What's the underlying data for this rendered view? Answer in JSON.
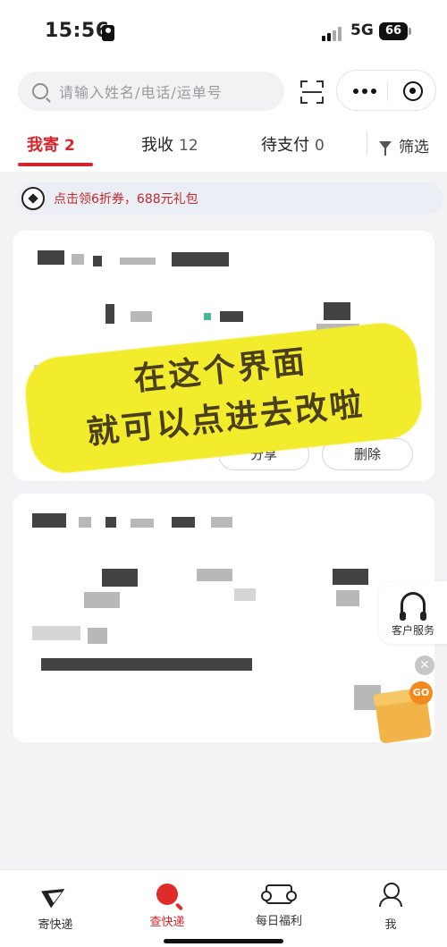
{
  "status_bar": {
    "time": "15:56",
    "network": "5G",
    "battery": "66"
  },
  "search": {
    "placeholder": "请输入姓名/电话/运单号"
  },
  "tabs": [
    {
      "label": "我寄",
      "count": "2",
      "active": true
    },
    {
      "label": "我收",
      "count": "12",
      "active": false
    },
    {
      "label": "待支付",
      "count": "0",
      "active": false
    }
  ],
  "filter_label": "筛选",
  "promo": {
    "text": "点击领6折券，688元礼包"
  },
  "card1": {
    "share_label": "分享",
    "delete_label": "删除"
  },
  "overlay": {
    "line1": "在这个界面",
    "line2": "就可以点进去改啦"
  },
  "customer_service": {
    "label": "客户服务"
  },
  "float": {
    "go_label": "GO"
  },
  "bottom_nav": [
    {
      "label": "寄快递",
      "icon": "send-icon"
    },
    {
      "label": "查快递",
      "icon": "query-icon",
      "active": true
    },
    {
      "label": "每日福利",
      "icon": "ticket-icon"
    },
    {
      "label": "我",
      "icon": "person-icon"
    }
  ],
  "colors": {
    "accent": "#d9232a",
    "sticker": "#f3ec2c"
  }
}
